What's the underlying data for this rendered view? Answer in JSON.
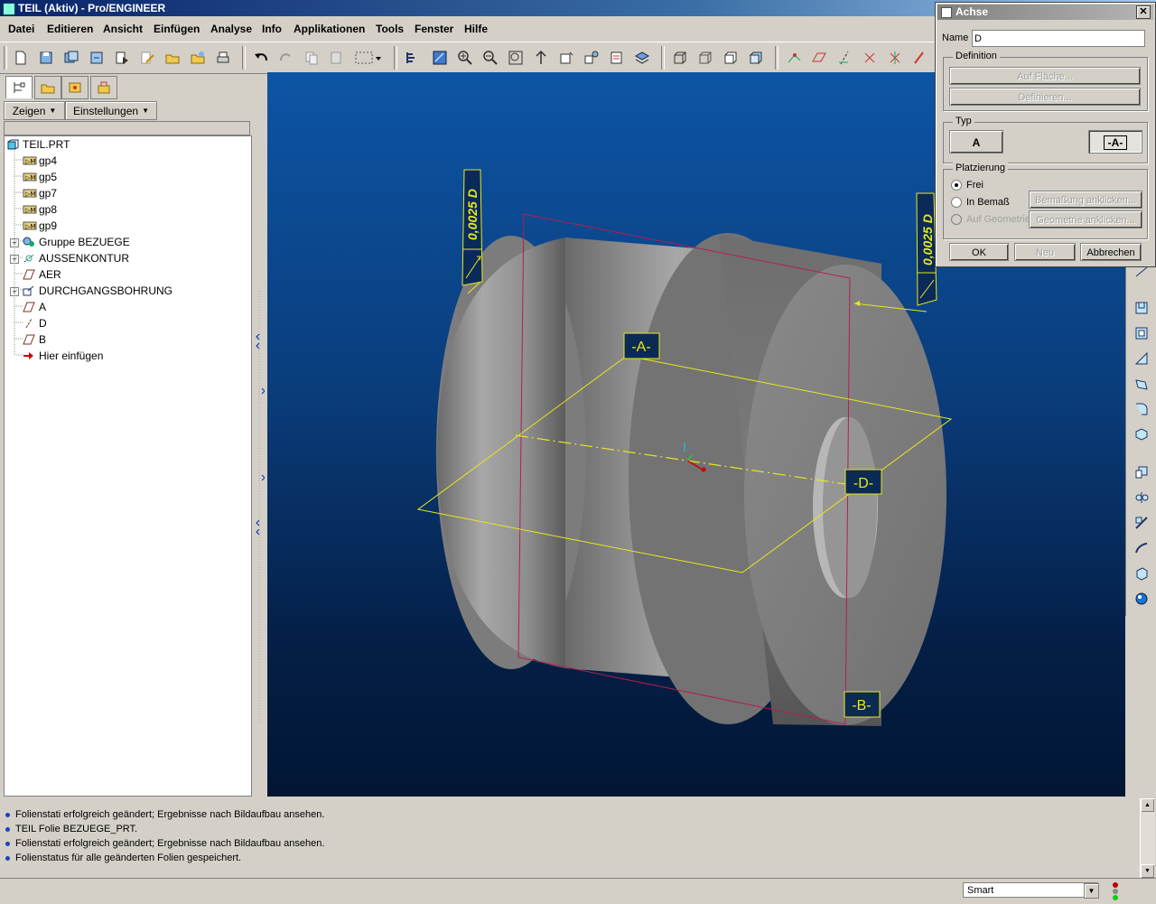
{
  "window": {
    "title": "TEIL (Aktiv) - Pro/ENGINEER"
  },
  "menu": [
    {
      "label": "Datei"
    },
    {
      "label": "Editieren"
    },
    {
      "label": "Ansicht"
    },
    {
      "label": "Einfügen"
    },
    {
      "label": "Analyse"
    },
    {
      "label": "Info"
    },
    {
      "label": "Applikationen"
    },
    {
      "label": "Tools"
    },
    {
      "label": "Fenster"
    },
    {
      "label": "Hilfe"
    }
  ],
  "navigator": {
    "show_label": "Zeigen",
    "settings_label": "Einstellungen",
    "tree": [
      {
        "label": "TEIL.PRT",
        "icon": "part-icon"
      },
      {
        "label": "gp4",
        "icon": "feature-icon"
      },
      {
        "label": "gp5",
        "icon": "feature-icon"
      },
      {
        "label": "gp7",
        "icon": "feature-icon"
      },
      {
        "label": "gp8",
        "icon": "feature-icon"
      },
      {
        "label": "gp9",
        "icon": "feature-icon"
      },
      {
        "label": "Gruppe BEZUEGE",
        "icon": "group-icon"
      },
      {
        "label": "AUSSENKONTUR",
        "icon": "revolve-icon"
      },
      {
        "label": "AER",
        "icon": "datum-plane-icon"
      },
      {
        "label": "DURCHGANGSBOHRUNG",
        "icon": "hole-icon"
      },
      {
        "label": "A",
        "icon": "datum-plane-icon"
      },
      {
        "label": "D",
        "icon": "datum-axis-icon"
      },
      {
        "label": "B",
        "icon": "datum-plane-icon"
      },
      {
        "label": "Hier einfügen",
        "icon": "insert-here-icon"
      }
    ]
  },
  "viewport": {
    "labels": {
      "a": "-A-",
      "b": "-B-",
      "d": "-D-"
    },
    "tolerance_left": "0,0025 D",
    "tolerance_right": "0,0025 D"
  },
  "dialog": {
    "title": "Achse",
    "name_label": "Name",
    "name_value": "D",
    "definition_label": "Definition",
    "on_surface_btn": "Auf Fläche...",
    "define_btn": "Definieren...",
    "type_label": "Typ",
    "type_a": "A",
    "type_axis": "-A-",
    "placement_label": "Platzierung",
    "free_label": "Frei",
    "in_dim_label": "In Bemaß",
    "on_geom_label": "Auf Geometrie",
    "pick_dim_btn": "Bemaßung anklicken...",
    "pick_geom_btn": "Geometrie anklicken...",
    "ok": "OK",
    "new": "Neu",
    "cancel": "Abbrechen"
  },
  "messages": [
    "Folienstati erfolgreich geändert; Ergebnisse nach Bildaufbau ansehen.",
    "TEIL Folie BEZUEGE_PRT.",
    "Folienstati erfolgreich geändert; Ergebnisse nach Bildaufbau ansehen.",
    "Folienstatus für alle geänderten Folien gespeichert."
  ],
  "statusbar": {
    "filter": "Smart"
  },
  "colors": {
    "viewport_top": "#0d55a5",
    "viewport_bottom": "#021634",
    "datum_yellow": "#e8e81c",
    "datum_red": "#a02040"
  }
}
